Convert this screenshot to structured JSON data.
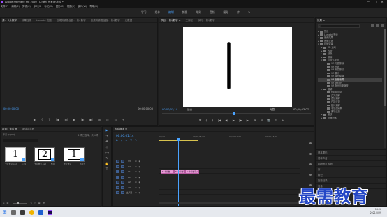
{
  "window": {
    "title": "Adobe Premiere Pro 2020 - D:\\我们的家庭\\卡片 *",
    "controls": [
      "—",
      "□",
      "✕"
    ]
  },
  "menu": [
    "文件(F)",
    "编辑(E)",
    "剪辑(C)",
    "序列(S)",
    "标记(M)",
    "图形(G)",
    "视图(V)",
    "窗口(W)",
    "帮助(H)"
  ],
  "workspaces": {
    "items": [
      "学习",
      "组件",
      "编辑",
      "颜色",
      "效果",
      "音频",
      "图形",
      "库"
    ],
    "active_index": 2,
    "more": "»"
  },
  "source_panel": {
    "tabs": [
      "源：卡片数字",
      "效果控件",
      "Lumetri 范围",
      "音频剪辑混合器：卡片数字",
      "音频剪辑混合器：卡片数字",
      "元数据"
    ],
    "active_tab": 0,
    "timecode_left": "00;00;00;00",
    "timecode_right": "00;00;00;00",
    "controls": [
      "◆",
      "{",
      "}",
      "|◀",
      "◀|",
      "▶",
      "|▶",
      "▶|",
      "⊞",
      "⊟",
      "⊡",
      "+"
    ]
  },
  "program_panel": {
    "tabs": [
      "节目：卡片数字 ≡",
      "工作区",
      "序列：卡片数字"
    ],
    "active_tab": 0,
    "timecode_left": "00;00;01;14",
    "fit": "适合",
    "quality": "完整",
    "timecode_right": "00;00;03;07",
    "playhead_fraction": 0.47,
    "controls": [
      "▼",
      "{",
      "}",
      "|◀",
      "◀|",
      "▶",
      "|▶",
      "▶|",
      "⊞",
      "⊟",
      "📷",
      "⊡",
      "+"
    ]
  },
  "effects_panel": {
    "tab": "效果 ≡",
    "tree": [
      {
        "label": "预设",
        "depth": 0,
        "expanded": false,
        "selected": false
      },
      {
        "label": "Lumetri 预设",
        "depth": 0,
        "expanded": false,
        "selected": false
      },
      {
        "label": "音频效果",
        "depth": 0,
        "expanded": false,
        "selected": false
      },
      {
        "label": "音频过渡",
        "depth": 0,
        "expanded": false,
        "selected": false
      },
      {
        "label": "视频效果",
        "depth": 0,
        "expanded": true,
        "selected": false
      },
      {
        "label": "3D 运动",
        "depth": 1,
        "expanded": false,
        "selected": false
      },
      {
        "label": "内滑",
        "depth": 1,
        "expanded": false,
        "selected": false
      },
      {
        "label": "划像",
        "depth": 1,
        "expanded": false,
        "selected": false
      },
      {
        "label": "擦除",
        "depth": 1,
        "expanded": false,
        "selected": false
      },
      {
        "label": "沉浸式视频",
        "depth": 1,
        "expanded": true,
        "selected": false
      },
      {
        "label": "VR 光圈擦除",
        "depth": 2,
        "expanded": false,
        "selected": false
      },
      {
        "label": "VR 光线",
        "depth": 2,
        "expanded": false,
        "selected": false
      },
      {
        "label": "VR 渐变擦除",
        "depth": 2,
        "expanded": false,
        "selected": false
      },
      {
        "label": "VR 漏光",
        "depth": 2,
        "expanded": false,
        "selected": false
      },
      {
        "label": "VR 球形模糊",
        "depth": 2,
        "expanded": false,
        "selected": false
      },
      {
        "label": "VR 色度泄漏",
        "depth": 2,
        "expanded": false,
        "selected": true
      },
      {
        "label": "VR 随机块",
        "depth": 2,
        "expanded": false,
        "selected": false
      },
      {
        "label": "VR 默比乌斯缩放",
        "depth": 2,
        "expanded": false,
        "selected": false
      },
      {
        "label": "溶解",
        "depth": 1,
        "expanded": true,
        "selected": false
      },
      {
        "label": "MorphCut",
        "depth": 2,
        "expanded": false,
        "selected": false
      },
      {
        "label": "交叉溶解",
        "depth": 2,
        "expanded": false,
        "selected": false
      },
      {
        "label": "叠加溶解",
        "depth": 2,
        "expanded": false,
        "selected": false
      },
      {
        "label": "白场过渡",
        "depth": 2,
        "expanded": false,
        "selected": false
      },
      {
        "label": "胶片溶解",
        "depth": 2,
        "expanded": false,
        "selected": false
      },
      {
        "label": "非叠加溶解",
        "depth": 2,
        "expanded": false,
        "selected": false
      },
      {
        "label": "黑场过渡",
        "depth": 2,
        "expanded": false,
        "selected": false
      },
      {
        "label": "缩放",
        "depth": 1,
        "expanded": false,
        "selected": false
      },
      {
        "label": "页面剥落",
        "depth": 1,
        "expanded": false,
        "selected": false
      }
    ]
  },
  "extra_panels": [
    "基本图形",
    "基本声音",
    "Lumetri 颜色",
    "库",
    "标记",
    "历史记录",
    "信息"
  ],
  "project_panel": {
    "tabs": [
      "项目：卡片 ≡",
      "媒体浏览器"
    ],
    "active_tab": 0,
    "project_file": "卡片.prproj",
    "items_count": "1 项已选择，共 4 项",
    "thumbs": [
      {
        "label": "卡片数字.psd",
        "duration": "4:29",
        "digit": "1",
        "boxed": false,
        "selected": true
      },
      {
        "label": "卡片数字.psd",
        "duration": "5:00",
        "digit": "2",
        "boxed": true,
        "selected": false
      },
      {
        "label": "卡片数字",
        "duration": "3:07",
        "digit": "1",
        "boxed": true,
        "selected": false
      }
    ]
  },
  "tools": [
    "▶",
    "⇥",
    "✥",
    "◇",
    "⟷",
    "✎",
    "✋",
    "T"
  ],
  "timeline": {
    "tab": "卡片数字 ≡",
    "timecode": "00;00;01;14",
    "ruler_labels": [
      "00;00",
      "00;00;05;00",
      "00;00;10;00",
      "00;00;15;00"
    ],
    "tracks": [
      {
        "name": "V3",
        "toggle_on": false
      },
      {
        "name": "V2",
        "toggle_on": false
      },
      {
        "name": "V1",
        "toggle_on": true
      },
      {
        "name": "A1",
        "toggle_on": true
      },
      {
        "name": "A2",
        "toggle_on": false
      },
      {
        "name": "A3",
        "toggle_on": false
      },
      {
        "name": "主声道",
        "toggle_on": false
      }
    ],
    "clips": [
      {
        "label": "fx 卡片数",
        "track": 2
      },
      {
        "label": "fx 卡片数字",
        "track": 2
      },
      {
        "label": "fx 卡片数字.ps",
        "track": 2
      }
    ]
  },
  "taskbar": {
    "time": "16:26",
    "date": "2021/5/29"
  },
  "watermark": "最需教育",
  "colors": {
    "accent": "#4aa3ff",
    "clip": "#e89ad6",
    "workbar": "#d7c24e"
  }
}
